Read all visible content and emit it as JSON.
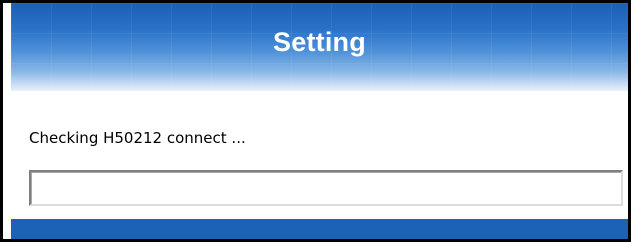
{
  "header": {
    "title": "Setting"
  },
  "status": {
    "message": "Checking H50212 connect ..."
  },
  "progress": {
    "value_percent": 0
  },
  "colors": {
    "header_top": "#1c5fb5",
    "header_bottom": "#e8f2fb",
    "footer": "#1c63b8",
    "border": "#000000"
  }
}
